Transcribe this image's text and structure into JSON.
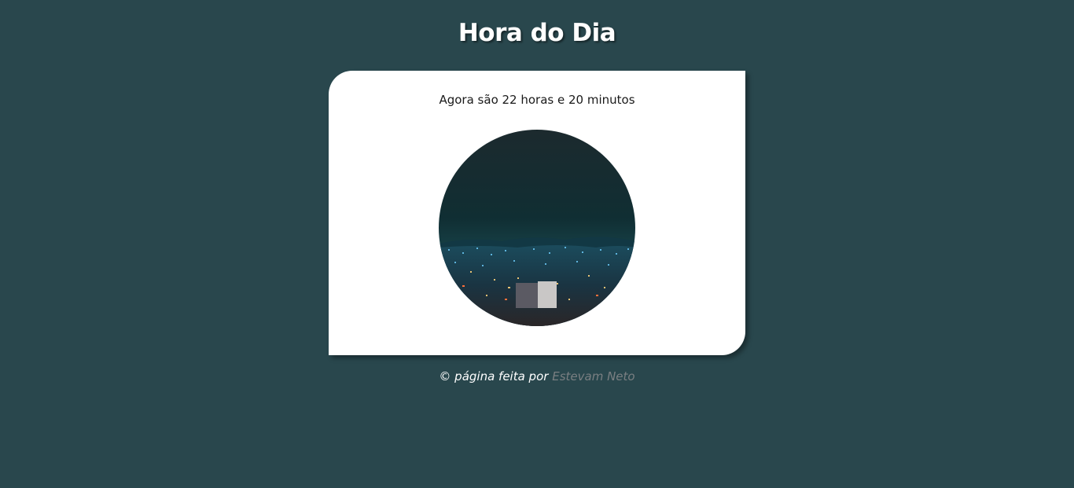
{
  "header": {
    "title": "Hora do Dia"
  },
  "card": {
    "time_message": "Agora são 22 horas e 20 minutos",
    "image_icon": "night-city-photo"
  },
  "footer": {
    "prefix": "© página feita por",
    "author_link": "Estevam Neto"
  },
  "colors": {
    "background": "#29474d",
    "card": "#ffffff",
    "link": "#7a7f82"
  }
}
